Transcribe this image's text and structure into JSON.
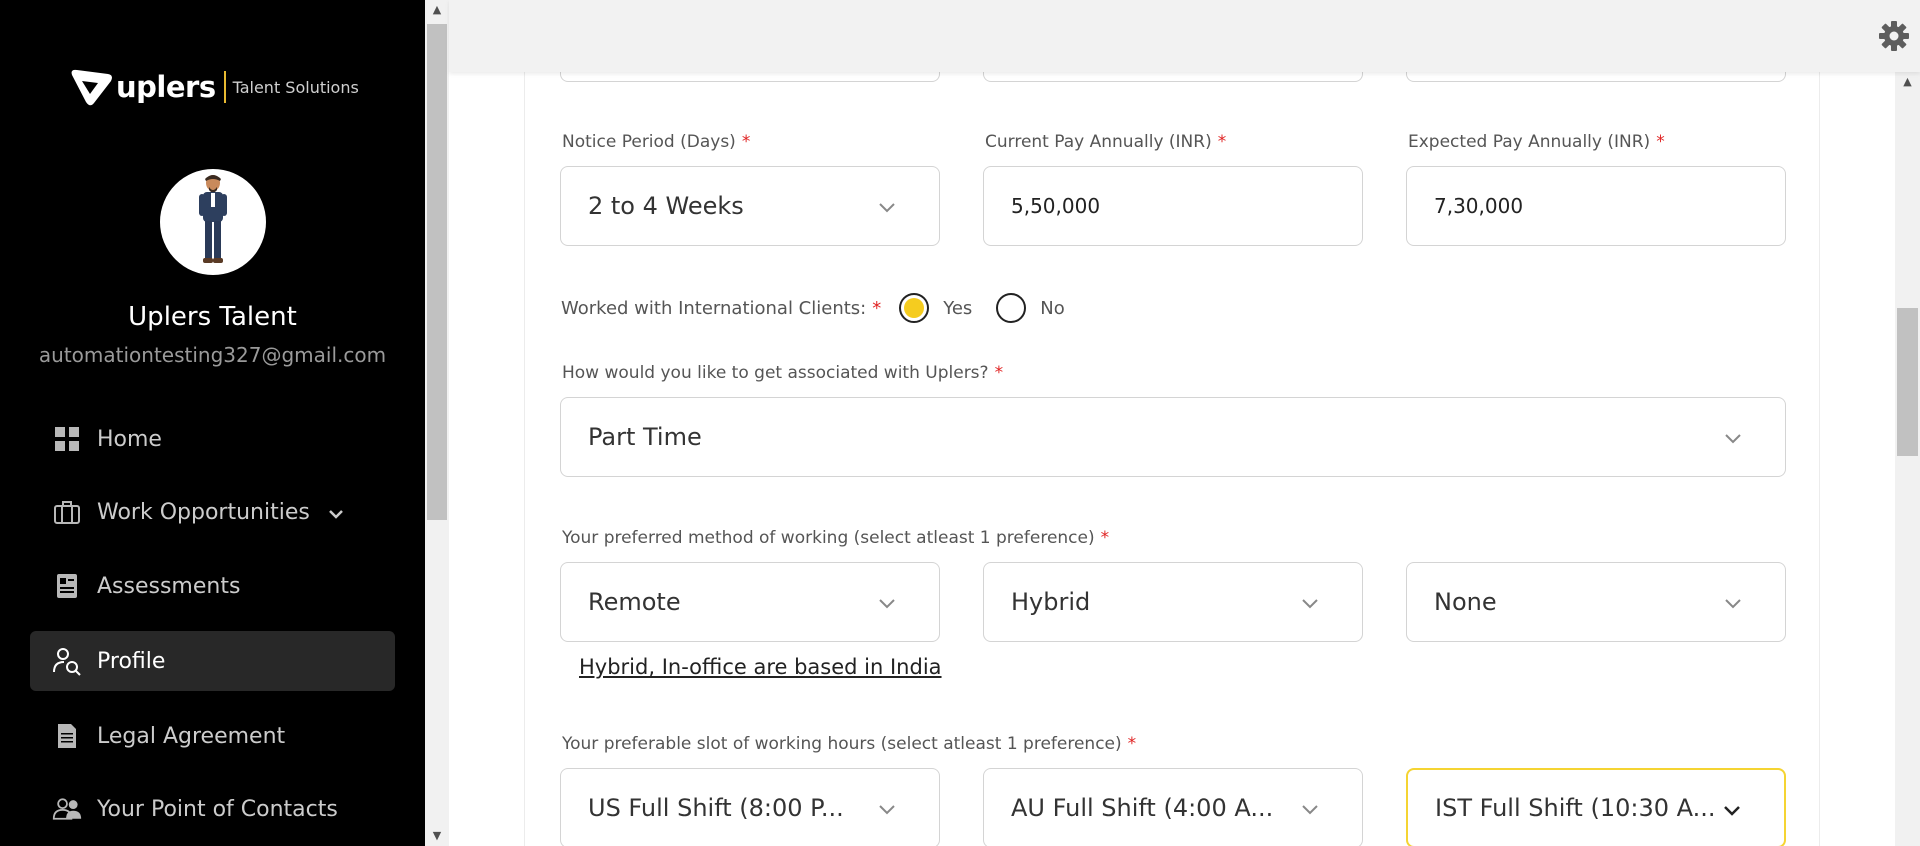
{
  "brand": {
    "name": "uplers",
    "tagline": "Talent Solutions",
    "accent": "#e7b931"
  },
  "user": {
    "name": "Uplers Talent",
    "email": "automationtesting327@gmail.com"
  },
  "nav": [
    {
      "label": "Home",
      "icon": "grid-icon"
    },
    {
      "label": "Work Opportunities",
      "icon": "briefcase-icon"
    },
    {
      "label": "Assessments",
      "icon": "assessment-icon"
    },
    {
      "label": "Profile",
      "icon": "profile-search-icon",
      "active": true
    },
    {
      "label": "Legal Agreement",
      "icon": "document-icon"
    },
    {
      "label": "Your Point of Contacts",
      "icon": "contacts-icon"
    }
  ],
  "form": {
    "notice": {
      "label": "Notice Period (Days)",
      "value": "2 to 4 Weeks"
    },
    "current_pay": {
      "label": "Current Pay Annually (INR)",
      "value": "5,50,000"
    },
    "expected_pay": {
      "label": "Expected Pay Annually (INR)",
      "value": "7,30,000"
    },
    "intl": {
      "label": "Worked with International Clients:",
      "yes": "Yes",
      "no": "No",
      "selected": "Yes"
    },
    "association": {
      "label": "How would you like to get associated with Uplers?",
      "value": "Part Time"
    },
    "method": {
      "label": "Your preferred method of working (select atleast 1 preference)",
      "options": [
        "Remote",
        "Hybrid",
        "None"
      ],
      "note": "Hybrid, In-office are based in India"
    },
    "slot": {
      "label": "Your preferable slot of working hours (select atleast 1 preference)",
      "options": [
        "US Full Shift (8:00 P...",
        "AU Full Shift (4:00 A...",
        "IST Full Shift (10:30 A..."
      ]
    },
    "required_mark": "*"
  },
  "colors": {
    "radio_selected": "#f5cc1f",
    "focus_border": "#f5d432",
    "required": "#e02424"
  }
}
